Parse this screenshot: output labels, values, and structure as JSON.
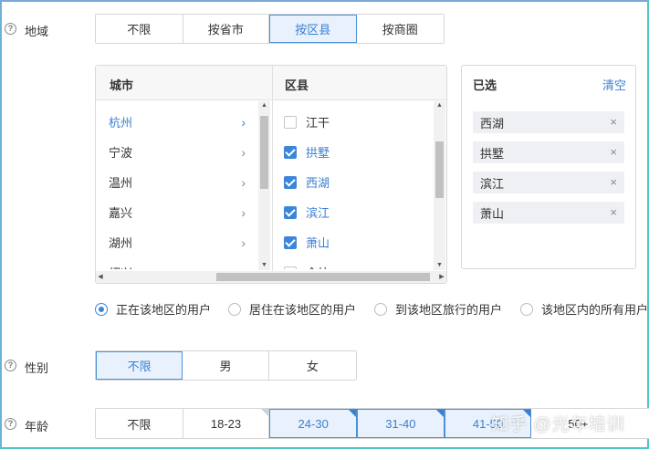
{
  "region": {
    "label": "地域",
    "options": [
      "不限",
      "按省市",
      "按区县",
      "按商圈"
    ],
    "selected_index": 2
  },
  "picker": {
    "city_header": "城市",
    "district_header": "区县",
    "cities": [
      {
        "name": "杭州",
        "selected": true
      },
      {
        "name": "宁波",
        "selected": false
      },
      {
        "name": "温州",
        "selected": false
      },
      {
        "name": "嘉兴",
        "selected": false
      },
      {
        "name": "湖州",
        "selected": false
      },
      {
        "name": "绍兴",
        "selected": false
      }
    ],
    "districts": [
      {
        "name": "江干",
        "checked": false
      },
      {
        "name": "拱墅",
        "checked": true
      },
      {
        "name": "西湖",
        "checked": true
      },
      {
        "name": "滨江",
        "checked": true
      },
      {
        "name": "萧山",
        "checked": true
      },
      {
        "name": "余杭",
        "checked": false
      }
    ]
  },
  "selected_panel": {
    "title": "已选",
    "clear_label": "清空",
    "tags": [
      "西湖",
      "拱墅",
      "滨江",
      "萧山"
    ]
  },
  "user_scope": {
    "options": [
      "正在该地区的用户",
      "居住在该地区的用户",
      "到该地区旅行的用户",
      "该地区内的所有用户"
    ],
    "selected_index": 0
  },
  "gender": {
    "label": "性别",
    "options": [
      "不限",
      "男",
      "女"
    ],
    "selected_index": 0
  },
  "age": {
    "label": "年龄",
    "options": [
      "不限",
      "18-23",
      "24-30",
      "31-40",
      "41-50",
      "50+"
    ],
    "selected": [
      2,
      3,
      4
    ]
  },
  "watermark": "知乎 @光年培训",
  "icons": {
    "help": "question-circle-icon",
    "chevron": "chevron-right-icon",
    "remove": "close-icon"
  },
  "colors": {
    "accent": "#3b86d9",
    "active_bg": "#e9f2fc"
  }
}
